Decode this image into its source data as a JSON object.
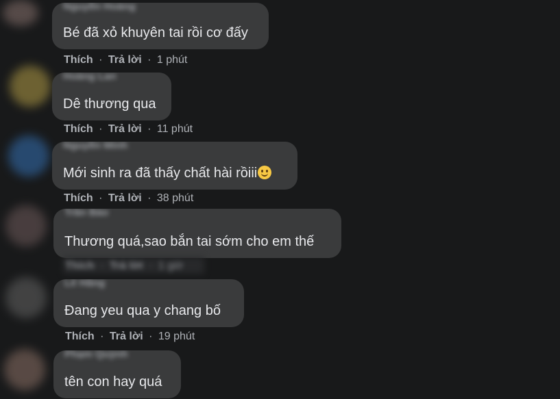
{
  "comments": [
    {
      "author": "Nguyễn Hoàng",
      "text": "Bé đã xỏ khuyên tai rồi cơ đấy",
      "like": "Thích",
      "reply": "Trả lời",
      "time": "1 phút"
    },
    {
      "author": "Hoàng Lan",
      "text": "Dê thương qua",
      "like": "Thích",
      "reply": "Trả lời",
      "time": "11 phút"
    },
    {
      "author": "Nguyễn Minh",
      "text": "Mới sinh ra đã thấy chất hài rồiii",
      "emoji": "slightly-smiling-face",
      "like": "Thích",
      "reply": "Trả lời",
      "time": "38 phút"
    },
    {
      "author": "Trần Bảo",
      "text": "Thương quá,sao bắn tai sớm cho em thế",
      "like": "Thích",
      "reply": "Trả lời",
      "time": "1 giờ"
    },
    {
      "author": "Lê Hằng",
      "text": "Đang yeu qua y chang bố",
      "like": "Thích",
      "reply": "Trả lời",
      "time": "19 phút"
    },
    {
      "author": "Phạm Quỳnh",
      "text": "tên con hay quá"
    }
  ],
  "separator": "·",
  "colors": {
    "background": "#18191a",
    "bubble": "#3a3b3c",
    "text": "#e8e9ec",
    "meta": "#b0b3b8"
  }
}
